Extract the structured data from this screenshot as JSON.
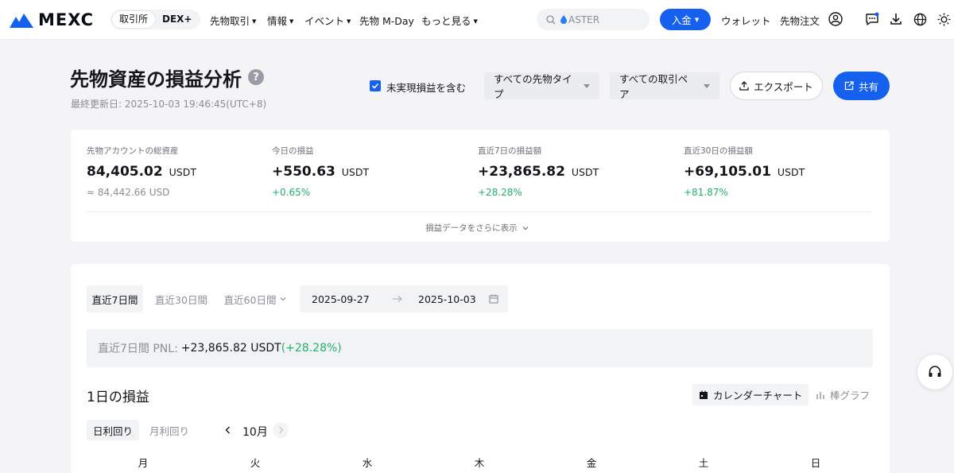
{
  "nav": {
    "brand": "MEXC",
    "segments": [
      "取引所",
      "DEX+"
    ],
    "menus": [
      "先物取引",
      "情報",
      "イベント",
      "先物 M-Day",
      "もっと見る"
    ],
    "search_placeholder": "ASTER",
    "deposit_label": "入金",
    "wallet_label": "ウォレット",
    "futures_orders_label": "先物注文"
  },
  "header": {
    "title": "先物資産の損益分析",
    "help_glyph": "?",
    "last_updated": "最終更新日: 2025-10-03 19:46:45(UTC+8)",
    "include_unrealized_label": "未実現損益を含む",
    "include_unrealized_checked": true,
    "futures_type_select": "すべての先物タイプ",
    "pair_select": "すべての取引ペア",
    "export_label": "エクスポート",
    "share_label": "共有"
  },
  "stats": [
    {
      "label": "先物アカウントの総資産",
      "value": "84,405.02",
      "unit": "USDT",
      "sub": "≈ 84,442.66 USD",
      "sub_type": "grey"
    },
    {
      "label": "今日の損益",
      "value": "+550.63",
      "unit": "USDT",
      "sub": "+0.65%",
      "sub_type": "green"
    },
    {
      "label": "直近7日の損益額",
      "value": "+23,865.82",
      "unit": "USDT",
      "sub": "+28.28%",
      "sub_type": "green"
    },
    {
      "label": "直近30日の損益額",
      "value": "+69,105.01",
      "unit": "USDT",
      "sub": "+81.87%",
      "sub_type": "green"
    }
  ],
  "show_more_label": "損益データをさらに表示",
  "period_tabs": [
    "直近7日間",
    "直近30日間",
    "直近60日間"
  ],
  "date_range": {
    "start": "2025-09-27",
    "end": "2025-10-03"
  },
  "pnl_summary": {
    "prefix": "直近7日間 PNL:",
    "value": "+23,865.82 USDT",
    "pct": "(+28.28%)"
  },
  "daily": {
    "title": "1日の損益",
    "calendar_label": "カレンダーチャート",
    "bar_label": "棒グラフ",
    "modes": [
      "日利回り",
      "月利回り"
    ],
    "month": "10月",
    "weekdays": [
      "月",
      "火",
      "水",
      "木",
      "金",
      "土",
      "日"
    ]
  },
  "colors": {
    "accent": "#1660f0",
    "positive": "#20b26c"
  }
}
